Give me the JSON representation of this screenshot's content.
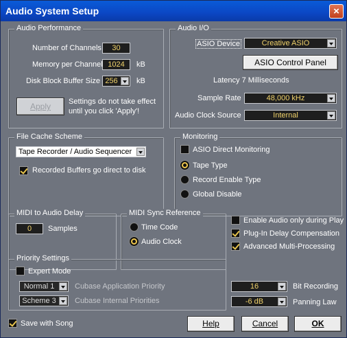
{
  "window": {
    "title": "Audio System Setup",
    "close_symbol": "×"
  },
  "audio_performance": {
    "legend": "Audio Performance",
    "channels_label": "Number of Channels",
    "channels_value": "30",
    "memory_label": "Memory per Channel",
    "memory_value": "1024",
    "memory_unit": "kB",
    "disk_label": "Disk Block Buffer Size",
    "disk_value": "256",
    "disk_unit": "kB",
    "apply_label": "Apply",
    "note_line1": "Settings do not take effect",
    "note_line2": "until you click 'Apply'!"
  },
  "audio_io": {
    "legend": "Audio I/O",
    "asio_device_label": "ASIO Device",
    "asio_device_value": "Creative ASIO",
    "asio_control_panel_label": "ASIO Control Panel",
    "latency_text": "Latency 7 Milliseconds",
    "sample_rate_label": "Sample Rate",
    "sample_rate_value": "48,000 kHz",
    "clock_source_label": "Audio Clock Source",
    "clock_source_value": "Internal"
  },
  "file_cache": {
    "legend": "File Cache Scheme",
    "scheme_value": "Tape Recorder / Audio Sequencer",
    "recorded_buffers_label": "Recorded Buffers go direct to disk",
    "recorded_buffers_checked": true
  },
  "monitoring": {
    "legend": "Monitoring",
    "asio_direct_label": "ASIO Direct Monitoring",
    "asio_direct_checked": false,
    "options": [
      {
        "label": "Tape Type",
        "selected": true
      },
      {
        "label": "Record Enable Type",
        "selected": false
      },
      {
        "label": "Global Disable",
        "selected": false
      }
    ]
  },
  "midi_audio_delay": {
    "legend": "MIDI to Audio Delay",
    "value": "0",
    "unit": "Samples"
  },
  "midi_sync": {
    "legend": "MIDI Sync Reference",
    "options": [
      {
        "label": "Time Code",
        "selected": false
      },
      {
        "label": "Audio Clock",
        "selected": true
      }
    ]
  },
  "options": {
    "enable_audio_label": "Enable Audio only during Play",
    "enable_audio_checked": false,
    "plugin_delay_label": "Plug-In Delay Compensation",
    "plugin_delay_checked": true,
    "multi_processing_label": "Advanced Multi-Processing",
    "multi_processing_checked": true
  },
  "priority": {
    "legend": "Priority Settings",
    "expert_label": "Expert Mode",
    "expert_checked": false,
    "app_priority_value": "Normal 1",
    "app_priority_label": "Cubase Application Priority",
    "internal_priority_value": "Scheme 3",
    "internal_priority_label": "Cubase Internal Priorities"
  },
  "bit_recording": {
    "value": "16",
    "label": "Bit Recording"
  },
  "panning_law": {
    "value": "-6 dB",
    "label": "Panning Law"
  },
  "footer": {
    "save_with_song_label": "Save with Song",
    "save_with_song_checked": true,
    "help_label": "Help",
    "cancel_label": "Cancel",
    "ok_label": "OK"
  },
  "colors": {
    "titlebar": "#0b47c4",
    "panel": "#6f747e",
    "field_bg": "#1e1e1e",
    "field_text": "#f0d26a"
  }
}
